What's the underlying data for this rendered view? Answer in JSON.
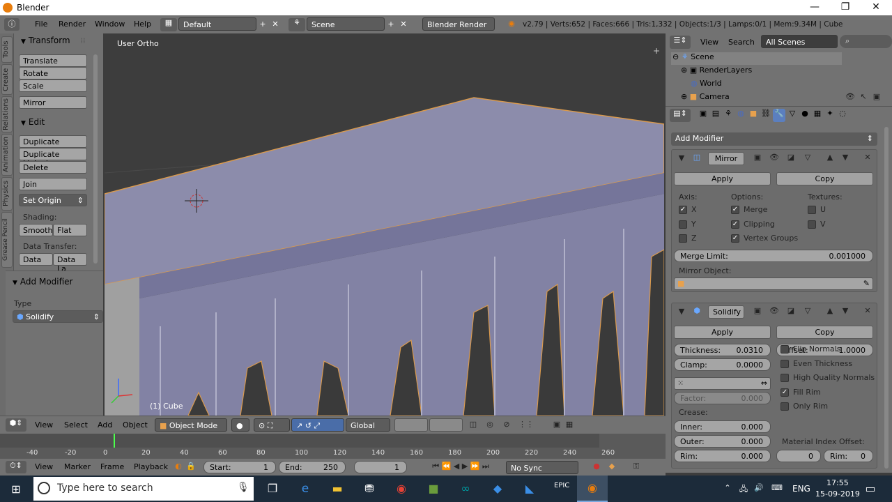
{
  "window": {
    "title": "Blender"
  },
  "info_header": {
    "menus": [
      "File",
      "Render",
      "Window",
      "Help"
    ],
    "layout": "Default",
    "scene": "Scene",
    "engine": "Blender Render",
    "stats": "v2.79 | Verts:652 | Faces:666 | Tris:1,332 | Objects:1/3 | Lamps:0/1 | Mem:9.34M | Cube"
  },
  "tool_tabs": [
    "Tools",
    "Create",
    "Relations",
    "Animation",
    "Physics",
    "Grease Pencil"
  ],
  "tool_shelf": {
    "transform_title": "Transform",
    "transform_buttons": [
      "Translate",
      "Rotate",
      "Scale",
      "Mirror"
    ],
    "edit_title": "Edit",
    "edit_buttons": [
      "Duplicate",
      "Duplicate Linked",
      "Delete",
      "Join"
    ],
    "set_origin": "Set Origin",
    "shading_label": "Shading:",
    "smooth": "Smooth",
    "flat": "Flat",
    "data_transfer_label": "Data Transfer:",
    "data": "Data",
    "data_layers": "Data La",
    "operator_title": "Add Modifier",
    "type_label": "Type",
    "type_value": "Solidify"
  },
  "viewport": {
    "view_label": "User Ortho",
    "object_label": "(1) Cube"
  },
  "outliner": {
    "view": "View",
    "search": "Search",
    "filter": "All Scenes",
    "items": [
      "Scene",
      "RenderLayers",
      "World",
      "Camera"
    ]
  },
  "properties": {
    "add_modifier": "Add Modifier",
    "mirror": {
      "name": "Mirror",
      "apply": "Apply",
      "copy": "Copy",
      "axis_label": "Axis:",
      "options_label": "Options:",
      "textures_label": "Textures:",
      "axes": [
        {
          "label": "X",
          "checked": true
        },
        {
          "label": "Y",
          "checked": false
        },
        {
          "label": "Z",
          "checked": false
        }
      ],
      "options": [
        {
          "label": "Merge",
          "checked": true
        },
        {
          "label": "Clipping",
          "checked": true
        },
        {
          "label": "Vertex Groups",
          "checked": true
        }
      ],
      "textures": [
        {
          "label": "U",
          "checked": false
        },
        {
          "label": "V",
          "checked": false
        }
      ],
      "merge_limit_label": "Merge Limit:",
      "merge_limit_value": "0.001000",
      "mirror_object_label": "Mirror Object:"
    },
    "solidify": {
      "name": "Solidify",
      "apply": "Apply",
      "copy": "Copy",
      "thickness_label": "Thickness:",
      "thickness_value": "0.0310",
      "offset_label": "Offset:",
      "offset_value": "-1.0000",
      "clamp_label": "Clamp:",
      "clamp_value": "0.0000",
      "factor_label": "Factor:",
      "factor_value": "0.000",
      "crease_label": "Crease:",
      "inner_label": "Inner:",
      "inner_value": "0.000",
      "outer_label": "Outer:",
      "outer_value": "0.000",
      "rim_label": "Rim:",
      "rim_value": "0.000",
      "options": [
        {
          "label": "Flip Normals",
          "checked": false
        },
        {
          "label": "Even Thickness",
          "checked": false
        },
        {
          "label": "High Quality Normals",
          "checked": false
        },
        {
          "label": "Fill Rim",
          "checked": true
        },
        {
          "label": "Only Rim",
          "checked": false
        }
      ],
      "material_index_label": "Material Index Offset:",
      "mat_value": "0",
      "mat_rim_label": "Rim:",
      "mat_rim_value": "0"
    }
  },
  "view3d_header": {
    "menus": [
      "View",
      "Select",
      "Add",
      "Object"
    ],
    "mode": "Object Mode",
    "orientation": "Global"
  },
  "timeline": {
    "ticks": [
      "-40",
      "-20",
      "0",
      "20",
      "40",
      "60",
      "80",
      "100",
      "120",
      "140",
      "160",
      "180",
      "200",
      "220",
      "240",
      "260"
    ],
    "menus": [
      "View",
      "Marker",
      "Frame",
      "Playback"
    ],
    "start_label": "Start:",
    "start_value": "1",
    "end_label": "End:",
    "end_value": "250",
    "current": "1",
    "sync": "No Sync"
  },
  "taskbar": {
    "search_placeholder": "Type here to search",
    "language": "ENG",
    "time": "17:55",
    "date": "15-09-2019"
  },
  "colors": {
    "accent": "#e87d0d",
    "panel": "#727272",
    "viewport": "#3d3d3d",
    "mesh": "#8a8aaa"
  }
}
